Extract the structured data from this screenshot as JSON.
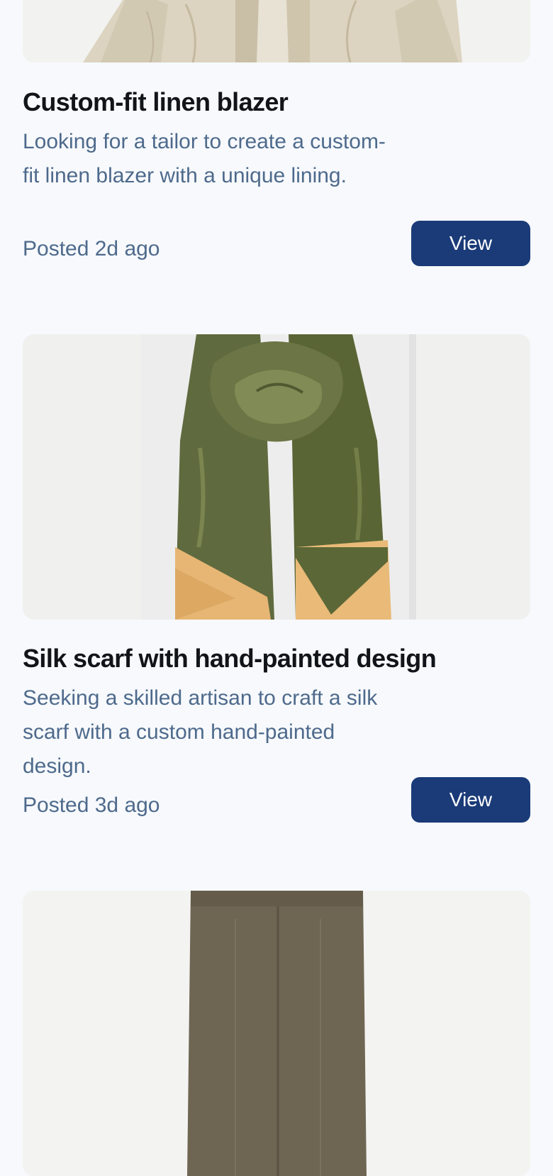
{
  "posts": [
    {
      "title": "Custom-fit linen blazer",
      "description": "Looking for a tailor to create a custom-fit linen blazer with a unique lining.",
      "posted": "Posted 2d ago",
      "button_label": "View",
      "image_icon": "linen-blazer-photo"
    },
    {
      "title": "Silk scarf with hand-painted design",
      "description": "Seeking a skilled artisan to craft a silk scarf with a custom hand-painted design.",
      "posted": "Posted 3d ago",
      "button_label": "View",
      "image_icon": "silk-scarf-photo"
    },
    {
      "image_icon": "trousers-photo"
    }
  ],
  "colors": {
    "background": "#f7f9fc",
    "title": "#111418",
    "secondary_text": "#4e6a8c",
    "button": "#1a3b78",
    "button_text": "#ffffff"
  }
}
